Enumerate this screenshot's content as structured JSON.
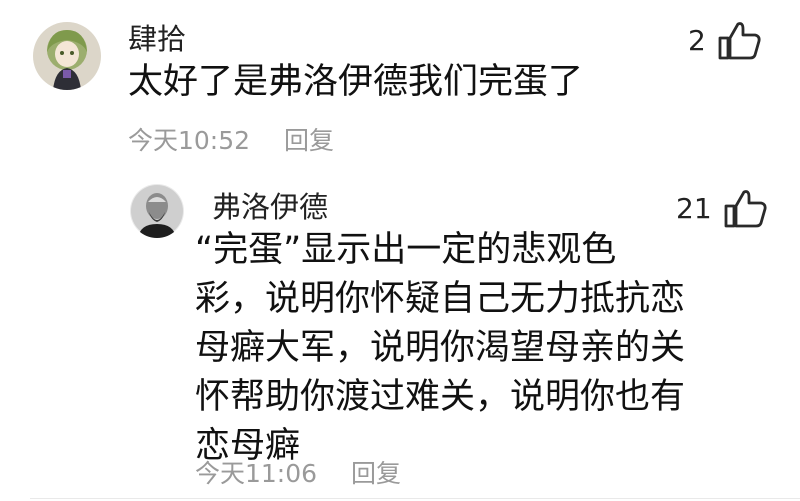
{
  "comments": [
    {
      "username": "肆拾",
      "text": "太好了是弗洛伊德我们完蛋了",
      "time": "今天10:52",
      "reply_label": "回复",
      "likes": "2",
      "avatar": "anime-girl-avatar"
    },
    {
      "username": "弗洛伊德",
      "text_lines": [
        "“完蛋”显示出一定的悲观色",
        "彩，说明你怀疑自己无力抵抗恋",
        "母癖大军，说明你渴望母亲的关",
        "怀帮助你渡过难关，说明你也有",
        "恋母癖"
      ],
      "time": "今天11:06",
      "reply_label": "回复",
      "likes": "21",
      "avatar": "freud-portrait-avatar"
    }
  ],
  "colors": {
    "text": "#111111",
    "meta": "#9a9a9a",
    "divider": "#e9e9e9",
    "background": "#ffffff"
  }
}
